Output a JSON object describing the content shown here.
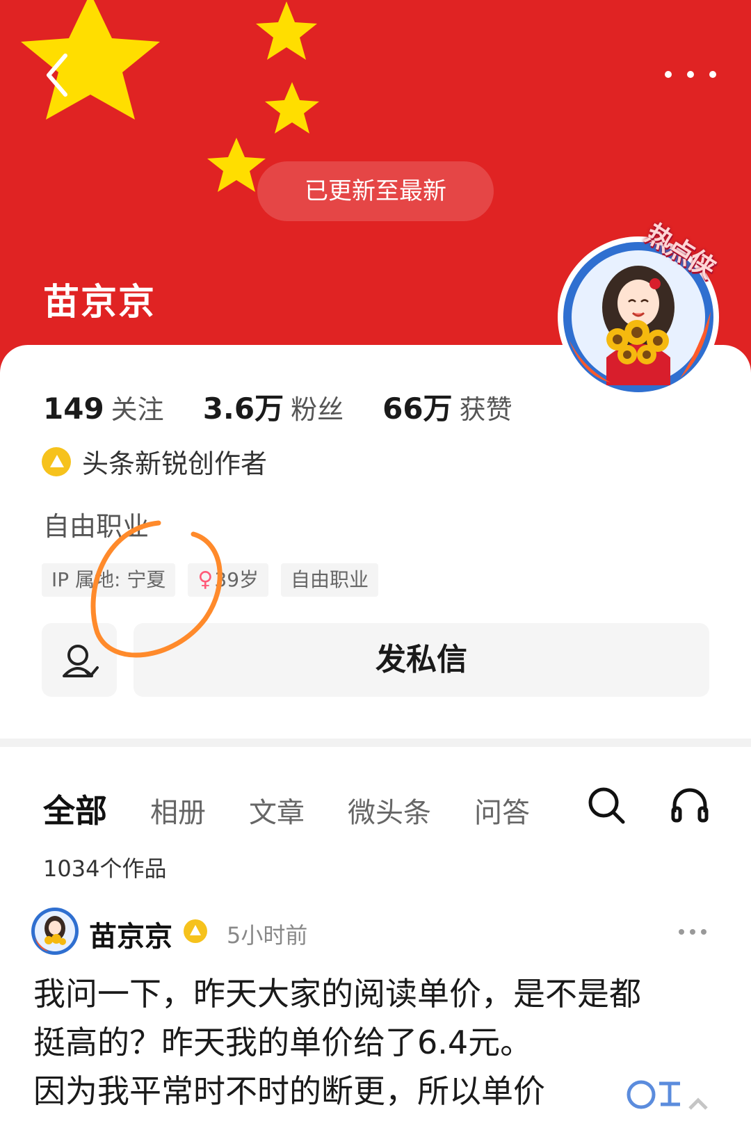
{
  "header": {
    "toast": "已更新至最新",
    "username": "苗京京",
    "avatar_badge": "热点侠"
  },
  "stats": [
    {
      "num": "149",
      "label": "关注"
    },
    {
      "num": "3.6万",
      "label": "粉丝"
    },
    {
      "num": "66万",
      "label": "获赞"
    }
  ],
  "creator_label": "头条新锐创作者",
  "bio": "自由职业",
  "tags": {
    "ip": "IP 属地: 宁夏",
    "age": "39岁",
    "job": "自由职业"
  },
  "actions": {
    "message": "发私信"
  },
  "tabs": [
    "全部",
    "相册",
    "文章",
    "微头条",
    "问答"
  ],
  "works_count": "1034个作品",
  "post": {
    "author": "苗京京",
    "time": "5小时前",
    "lines": [
      "我问一下，昨天大家的阅读单价，是不是都",
      "挺高的？昨天我的单价给了6.4元。",
      "因为我平常时不时的断更，所以单价"
    ]
  },
  "colors": {
    "header_red": "#e02323",
    "star_yellow": "#ffde00",
    "creator_gold": "#f6c21c",
    "annotation_orange": "#ff8a2b"
  }
}
